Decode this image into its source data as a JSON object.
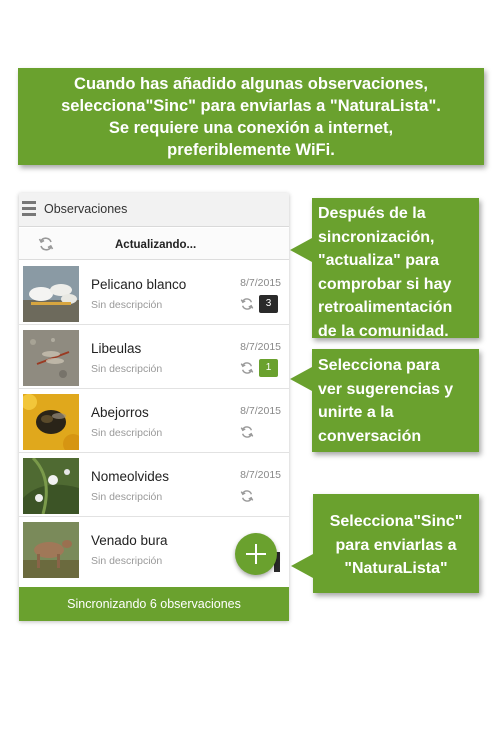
{
  "top_callout": {
    "line1": "Cuando has añadido algunas observaciones,",
    "line2": "selecciona\"Sinc\" para enviarlas a \"NaturaLista\".",
    "line3": "Se requiere una conexión a internet,",
    "line4": "preferiblemente WiFi."
  },
  "app": {
    "title": "Observaciones",
    "status_text": "Actualizando...",
    "bottom_bar": "Sincronizando 6 observaciones",
    "accent_color": "#6aa12e",
    "fab_icon": "plus-icon"
  },
  "observations": [
    {
      "name": "Pelicano blanco",
      "description": "Sin descripción",
      "date": "8/7/2015",
      "badge": "3",
      "badge_style": "dark"
    },
    {
      "name": "Libeulas",
      "description": "Sin descripción",
      "date": "8/7/2015",
      "badge": "1",
      "badge_style": "green"
    },
    {
      "name": "Abejorros",
      "description": "Sin descripción",
      "date": "8/7/2015"
    },
    {
      "name": "Nomeolvides",
      "description": "Sin descripción",
      "date": "8/7/2015"
    },
    {
      "name": "Venado bura",
      "description": "Sin descripción",
      "date": ""
    }
  ],
  "callouts": {
    "sync_update": [
      "Después de la",
      "sincronización,",
      "\"actualiza\" para",
      "comprobar si hay",
      "retroalimentación",
      "de la comunidad."
    ],
    "suggestions": [
      "Selecciona para",
      "ver sugerencias y",
      "unirte a la",
      "conversación"
    ],
    "sinc": [
      "Selecciona\"Sinc\"",
      "para enviarlas a",
      "\"NaturaLista\""
    ]
  }
}
